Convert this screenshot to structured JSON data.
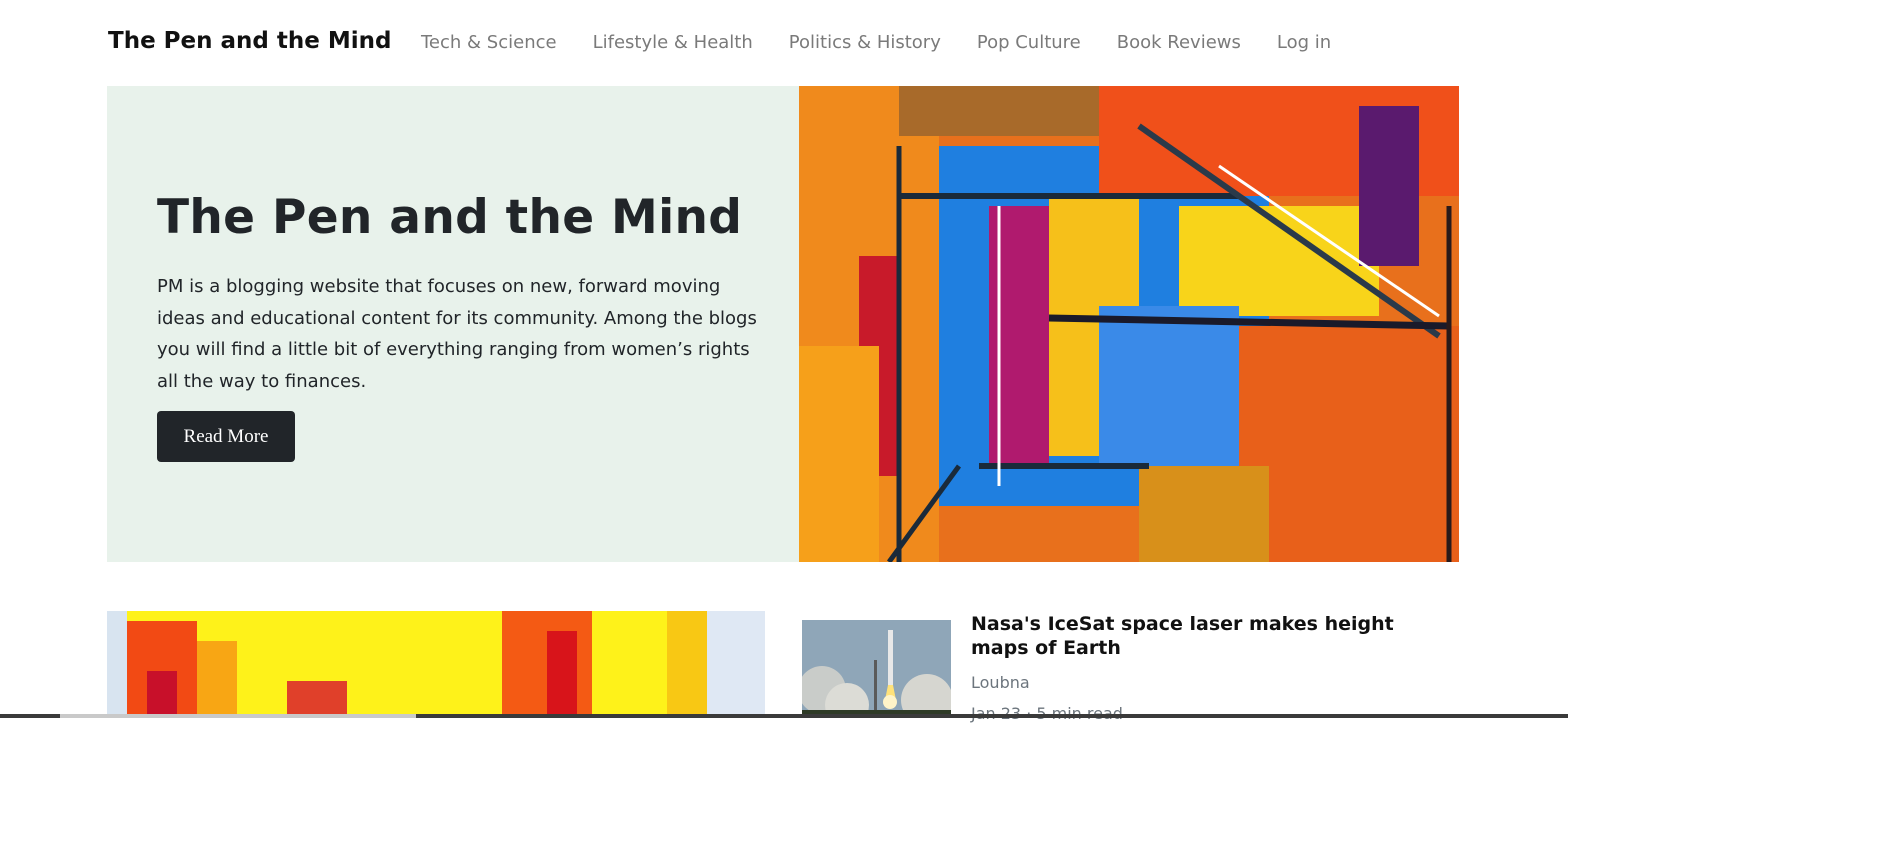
{
  "nav": {
    "brand": "The Pen and the Mind",
    "links": [
      "Tech & Science",
      "Lifestyle & Health",
      "Politics & History",
      "Pop Culture",
      "Book Reviews",
      "Log in"
    ]
  },
  "hero": {
    "title": "The Pen and the Mind",
    "description": "PM is a blogging website that focuses on new, forward moving ideas and educational content for its community. Among the blogs you will find a little bit of everything ranging from women’s rights all the way to finances.",
    "button_label": "Read More",
    "image": "abstract-painting"
  },
  "featured": {
    "image": "yellow-red-paint"
  },
  "post": {
    "title": "Nasa's IceSat space laser makes height maps of Earth",
    "author": "Loubna",
    "meta": "Jan 23 · 5 min read",
    "thumbnail": "rocket-launch"
  },
  "colors": {
    "hero_background": "#e8f2eb",
    "button_background": "#212529",
    "nav_link": "#7a7a7a"
  }
}
